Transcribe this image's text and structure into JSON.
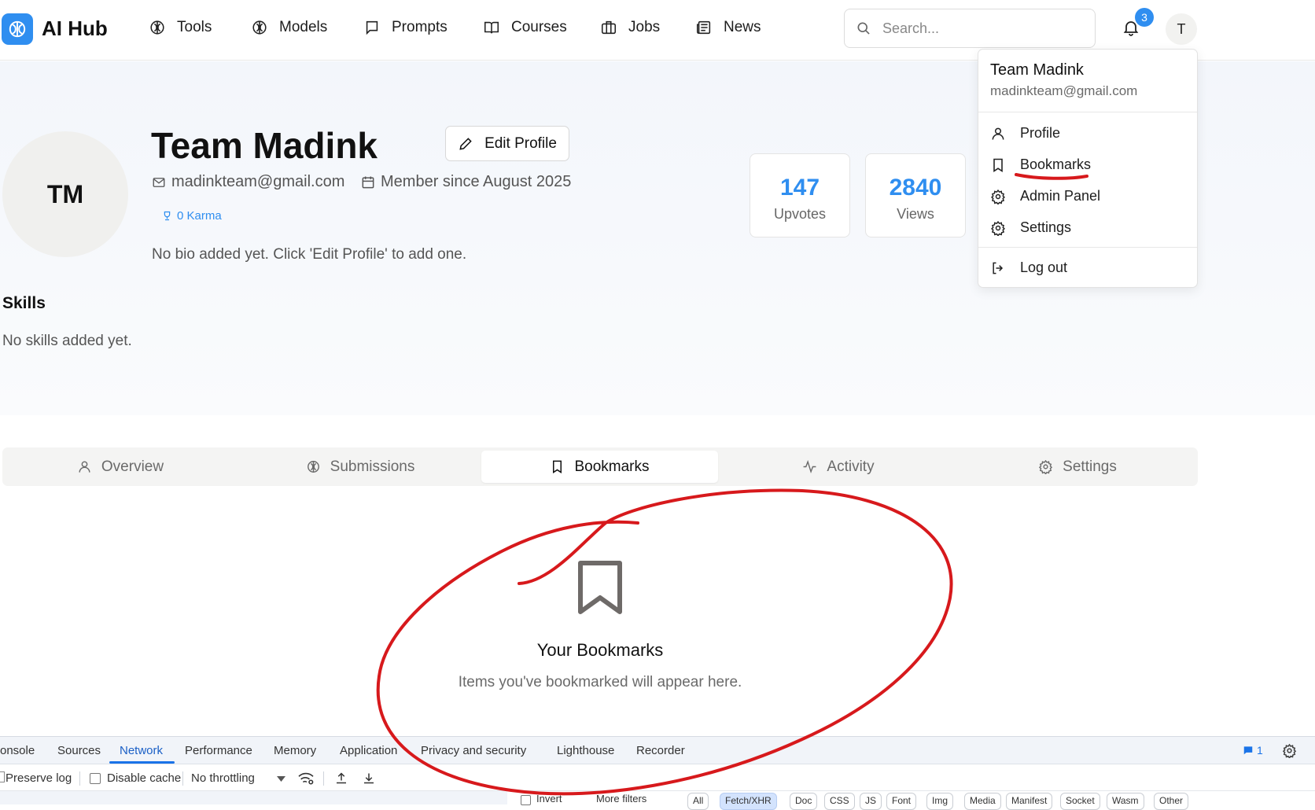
{
  "topbar": {
    "brand": "AI Hub",
    "nav": [
      {
        "label": "Tools",
        "icon": "brain-icon"
      },
      {
        "label": "Models",
        "icon": "brain-icon"
      },
      {
        "label": "Prompts",
        "icon": "message-icon"
      },
      {
        "label": "Courses",
        "icon": "book-icon"
      },
      {
        "label": "Jobs",
        "icon": "briefcase-icon"
      },
      {
        "label": "News",
        "icon": "newspaper-icon"
      }
    ],
    "search_placeholder": "Search...",
    "notification_count": "3",
    "user_initial": "T"
  },
  "profile": {
    "initials": "TM",
    "name": "Team Madink",
    "edit_label": "Edit Profile",
    "email": "madinkteam@gmail.com",
    "member_since": "Member since August 2025",
    "karma": "0 Karma",
    "bio": "No bio added yet. Click 'Edit Profile' to add one.",
    "skills_heading": "Skills",
    "skills_empty": "No skills added yet.",
    "stats": [
      {
        "value": "147",
        "label": "Upvotes"
      },
      {
        "value": "2840",
        "label": "Views"
      }
    ]
  },
  "dropdown": {
    "name": "Team Madink",
    "email": "madinkteam@gmail.com",
    "items": [
      {
        "label": "Profile",
        "icon": "user-icon"
      },
      {
        "label": "Bookmarks",
        "icon": "bookmark-icon"
      },
      {
        "label": "Admin Panel",
        "icon": "gear-icon"
      },
      {
        "label": "Settings",
        "icon": "gear-icon"
      },
      {
        "label": "Log out",
        "icon": "logout-icon"
      }
    ]
  },
  "tabs": [
    {
      "label": "Overview",
      "icon": "user-icon"
    },
    {
      "label": "Submissions",
      "icon": "brain-icon"
    },
    {
      "label": "Bookmarks",
      "icon": "bookmark-icon",
      "active": true
    },
    {
      "label": "Activity",
      "icon": "activity-icon"
    },
    {
      "label": "Settings",
      "icon": "gear-icon"
    }
  ],
  "empty_state": {
    "title": "Your Bookmarks",
    "subtitle": "Items you've bookmarked will appear here."
  },
  "devtools": {
    "tabs": [
      "onsole",
      "Sources",
      "Network",
      "Performance",
      "Memory",
      "Application",
      "Privacy and security",
      "Lighthouse",
      "Recorder"
    ],
    "active_tab": "Network",
    "issues_count": "1",
    "toolbar": {
      "preserve_log": "Preserve log",
      "disable_cache": "Disable cache",
      "throttling": "No throttling"
    },
    "filter_row": {
      "invert": "Invert",
      "more_filters": "More filters",
      "chips": [
        "All",
        "Fetch/XHR",
        "Doc",
        "CSS",
        "JS",
        "Font",
        "Img",
        "Media",
        "Manifest",
        "Socket",
        "Wasm",
        "Other"
      ]
    }
  },
  "colors": {
    "accent": "#2f8ef0",
    "annotation": "#d7191c"
  }
}
